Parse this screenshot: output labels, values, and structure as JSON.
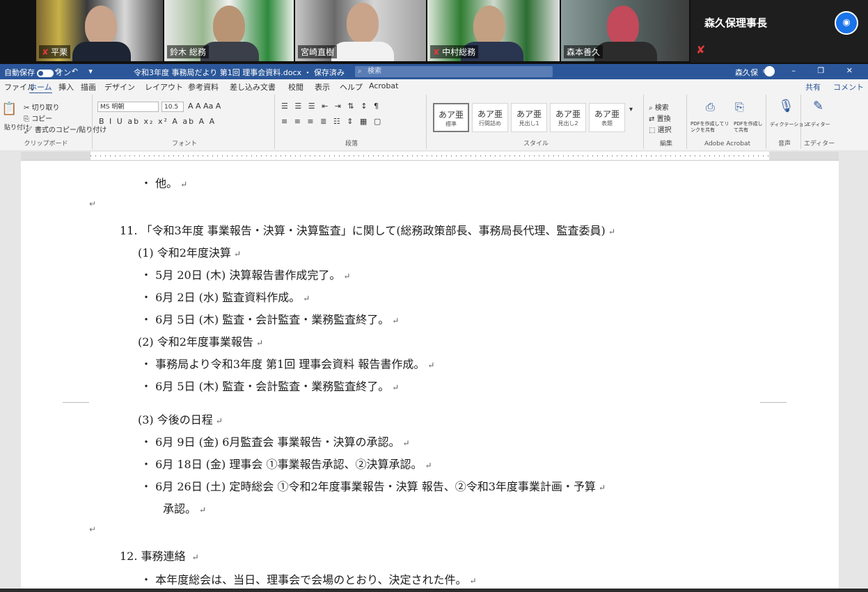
{
  "zoom": {
    "participants": [
      {
        "name": "平栗"
      },
      {
        "name": "鈴木  総務"
      },
      {
        "name": "宮崎直樹"
      },
      {
        "name": "中村総務"
      },
      {
        "name": "森本善久"
      }
    ],
    "host": {
      "name": "森久保理事長",
      "avatar": "◉"
    },
    "mic_off_icon": "✘"
  },
  "word": {
    "titlebar": {
      "autosave_label": "自動保存",
      "autosave_state": "オン",
      "qat": "⟲ ↶ ▾",
      "doc_title": "令和3年度 事務局だより 第1回 理事会資料.docx  ・ 保存済み",
      "search_placeholder": "検索",
      "user": "森久保",
      "window_controls": "▭ – ❐ ✕"
    },
    "tabs": [
      "ファイル",
      "ホーム",
      "挿入",
      "描画",
      "デザイン",
      "レイアウト",
      "参考資料",
      "差し込み文書",
      "校閲",
      "表示",
      "ヘルプ",
      "Acrobat"
    ],
    "share_label": "共有",
    "comment_label": "コメント",
    "ribbon": {
      "clipboard": {
        "paste": "貼り付け",
        "cut": "切り取り",
        "copy": "コピー",
        "format_painter": "書式のコピー/貼り付け",
        "label": "クリップボード"
      },
      "font": {
        "name": "MS 明朝",
        "size": "10.5",
        "row1": "A A Aa A",
        "row2": "B I U ab x₂ x² A ab A A",
        "label": "フォント"
      },
      "paragraph": {
        "row1": "☰ ☰ ☰ ⇤ ⇥ ⇅ ↕ ¶",
        "row2": "≡ ≡ ≡ ≣ ☷ ⇕ ▦ ▢",
        "label": "段落"
      },
      "styles": [
        {
          "sample": "あア亜",
          "name": "標準"
        },
        {
          "sample": "あア亜",
          "name": "行間詰め"
        },
        {
          "sample": "あア亜",
          "name": "見出し1"
        },
        {
          "sample": "あア亜",
          "name": "見出し2"
        },
        {
          "sample": "あア亜",
          "name": "表題"
        }
      ],
      "styles_label": "スタイル",
      "editing": {
        "find": "検索",
        "replace": "置換",
        "select": "選択",
        "label": "編集"
      },
      "acrobat": {
        "create_pdf": "PDFを作成してリンクを共有",
        "share": "PDFを作成して共有",
        "label": "Adobe Acrobat"
      },
      "dictate": {
        "label": "ディクテーション",
        "group": "音声"
      },
      "editor": {
        "label": "エディター",
        "group": "エディター"
      }
    }
  },
  "document": {
    "lines": [
      {
        "text": "・  他。"
      },
      {
        "text": "11. 「令和3年度 事業報告・決算・決算監査」に関して(総務政策部長、事務局長代理、監査委員)"
      },
      {
        "text": "(1)  令和2年度決算"
      },
      {
        "text": "・  5月 20日 (木)  決算報告書作成完了。"
      },
      {
        "text": "・  6月 2日 (水)  監査資料作成。"
      },
      {
        "text": "・  6月 5日 (木)  監査・会計監査・業務監査終了。"
      },
      {
        "text": "(2)  令和2年度事業報告"
      },
      {
        "text": "・  事務局より令和3年度 第1回 理事会資料 報告書作成。"
      },
      {
        "text": "・  6月 5日 (木)  監査・会計監査・業務監査終了。"
      },
      {
        "text": "(3)  今後の日程"
      },
      {
        "text": "・  6月 9日 (金)  6月監査会 事業報告・決算の承認。"
      },
      {
        "text": "・  6月 18日 (金)  理事会 ①事業報告承認、②決算承認。"
      },
      {
        "text": "・  6月 26日 (土)  定時総会 ①令和2年度事業報告・決算 報告、②令和3年度事業計画・予算"
      },
      {
        "text": "承認。"
      },
      {
        "text": "12. 事務連絡 "
      },
      {
        "text": "・  本年度総会は、当日、理事会で会場のとおり、決定された件。"
      }
    ]
  }
}
